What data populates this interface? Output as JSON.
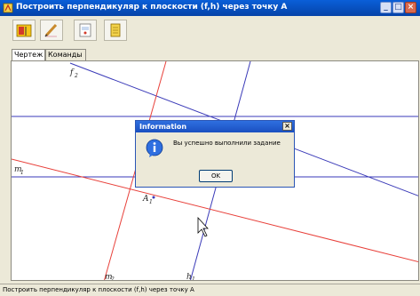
{
  "window": {
    "title": "Построить перпендикуляр к плоскости (f,h) через точку A",
    "minimize": "_",
    "maximize": "□",
    "close": "×"
  },
  "toolbar": {
    "buttons": [
      {
        "name": "drawing-tools",
        "icon": "flag-icon"
      },
      {
        "name": "pencil-tool",
        "icon": "pencil-icon"
      },
      {
        "name": "document-tool",
        "icon": "document-icon"
      },
      {
        "name": "notes-tool",
        "icon": "note-icon"
      }
    ]
  },
  "tabs": [
    {
      "label": "Чертеж",
      "active": true
    },
    {
      "label": "Команды",
      "active": false
    }
  ],
  "canvas": {
    "labels": {
      "f2": {
        "main": "f",
        "sub": "2"
      },
      "m1": {
        "main": "m",
        "sub": "1"
      },
      "a1": {
        "main": "A",
        "sub": "1"
      },
      "m2": {
        "main": "m",
        "sub": "2"
      },
      "h1": {
        "main": "h",
        "sub": "1"
      }
    },
    "colors": {
      "blue": "#3a3ab8",
      "red": "#e8403a"
    }
  },
  "dialog": {
    "title": "Information",
    "close": "×",
    "message": "Вы успешно выполнили задание",
    "ok": "OK",
    "icon": "info-icon"
  },
  "status": {
    "text": "Построить перпендикуляр к плоскости (f,h) через точку A"
  }
}
